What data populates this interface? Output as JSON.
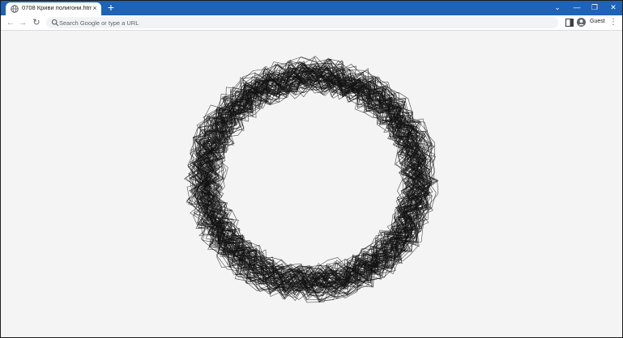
{
  "window": {
    "tab": {
      "title": "0708 Криви полигони.html",
      "close_glyph": "×",
      "favicon": "globe-icon"
    },
    "new_tab_glyph": "+",
    "controls": {
      "tab_search_glyph": "⌄",
      "minimize_glyph": "—",
      "restore_glyph": "❐",
      "close_glyph": "✕"
    }
  },
  "toolbar": {
    "back_glyph": "←",
    "forward_glyph": "→",
    "reload_glyph": "↻",
    "omnibox": {
      "placeholder": "Search Google or type a URL",
      "value": ""
    },
    "profile_label": "Guest",
    "menu_glyph": "⋮"
  },
  "page": {
    "background": "#f4f4f4",
    "stroke_color": "#111111"
  }
}
